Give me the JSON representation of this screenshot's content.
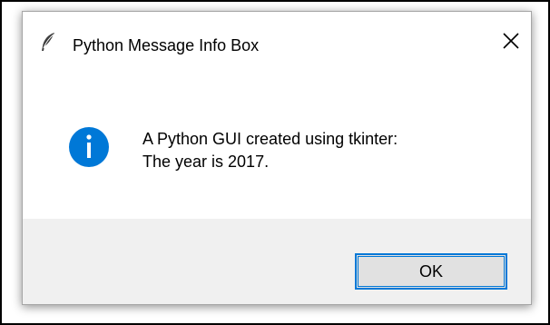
{
  "window": {
    "title": "Python Message Info Box",
    "app_icon": "feather-icon",
    "close_icon": "close-icon"
  },
  "message": {
    "icon": "info-icon",
    "line1": "A Python GUI created using tkinter:",
    "line2": "The year is 2017."
  },
  "buttons": {
    "ok_label": "OK"
  },
  "colors": {
    "info_icon_fill": "#0078d7",
    "button_focus_border": "#0078d7",
    "button_face": "#e1e1e1",
    "footer_background": "#f0f0f0"
  }
}
